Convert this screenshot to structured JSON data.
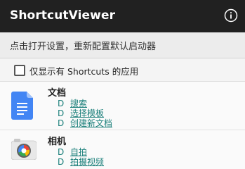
{
  "app": {
    "title": "ShortcutViewer"
  },
  "hint": "点击打开设置，重新配置默认启动器",
  "filter": {
    "label": "仅显示有 Shortcuts 的应用",
    "checked": false
  },
  "apps": [
    {
      "name": "文档",
      "icon": "google-docs-icon",
      "shortcuts": [
        {
          "prefix": "D",
          "label": "搜索"
        },
        {
          "prefix": "D",
          "label": "选择模板"
        },
        {
          "prefix": "D",
          "label": "创建新文档"
        }
      ]
    },
    {
      "name": "相机",
      "icon": "camera-icon",
      "shortcuts": [
        {
          "prefix": "D",
          "label": "自拍"
        },
        {
          "prefix": "D",
          "label": "拍摄视频"
        }
      ]
    }
  ],
  "colors": {
    "appbar": "#212121",
    "link": "#1a7f7a",
    "docs_blue": "#4285f4"
  }
}
